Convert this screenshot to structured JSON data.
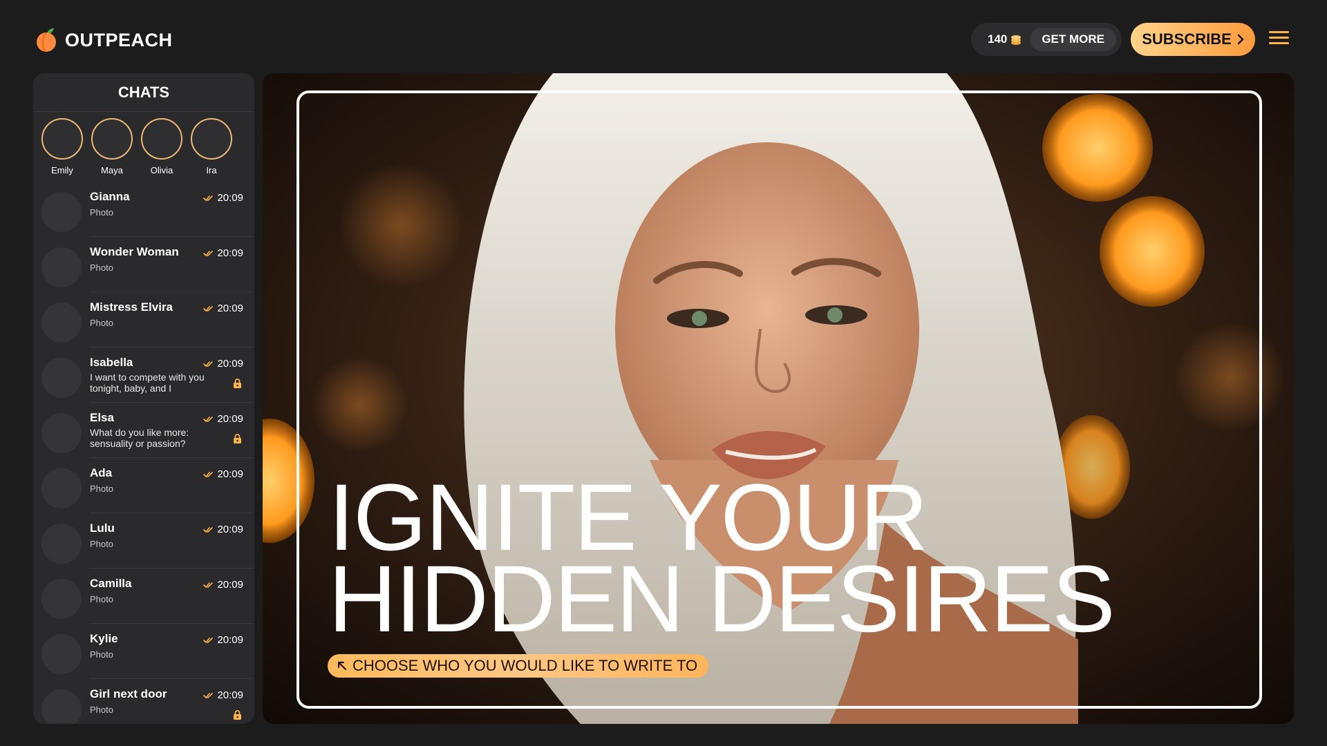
{
  "brand": {
    "name": "OUTPEACH"
  },
  "header": {
    "coins": "140",
    "get_more": "GET MORE",
    "subscribe": "SUBSCRIBE"
  },
  "sidebar": {
    "title": "CHATS",
    "stories": [
      "Emily",
      "Maya",
      "Olivia",
      "Ira"
    ],
    "chats": [
      {
        "name": "Gianna",
        "message": "Photo",
        "time": "20:09",
        "locked": false
      },
      {
        "name": "Wonder Woman",
        "message": "Photo",
        "time": "20:09",
        "locked": false
      },
      {
        "name": "Mistress Elvira",
        "message": "Photo",
        "time": "20:09",
        "locked": false
      },
      {
        "name": "Isabella",
        "message": "I want to compete with you tonight, baby, and I",
        "time": "20:09",
        "locked": true
      },
      {
        "name": "Elsa",
        "message": "What do you like more: sensuality or passion?",
        "time": "20:09",
        "locked": true
      },
      {
        "name": "Ada",
        "message": "Photo",
        "time": "20:09",
        "locked": false
      },
      {
        "name": "Lulu",
        "message": "Photo",
        "time": "20:09",
        "locked": false
      },
      {
        "name": "Camilla",
        "message": "Photo",
        "time": "20:09",
        "locked": false
      },
      {
        "name": "Kylie",
        "message": "Photo",
        "time": "20:09",
        "locked": false
      },
      {
        "name": "Girl next door",
        "message": "Photo",
        "time": "20:09",
        "locked": true
      }
    ]
  },
  "hero": {
    "headline_line1": "IGNITE YOUR",
    "headline_line2": "HIDDEN DESIRES",
    "cta": "CHOOSE WHO YOU WOULD LIKE TO WRITE TO"
  },
  "colors": {
    "accent": "#ffb24e",
    "background": "#1c1c1d",
    "panel": "#2a2a2c"
  }
}
